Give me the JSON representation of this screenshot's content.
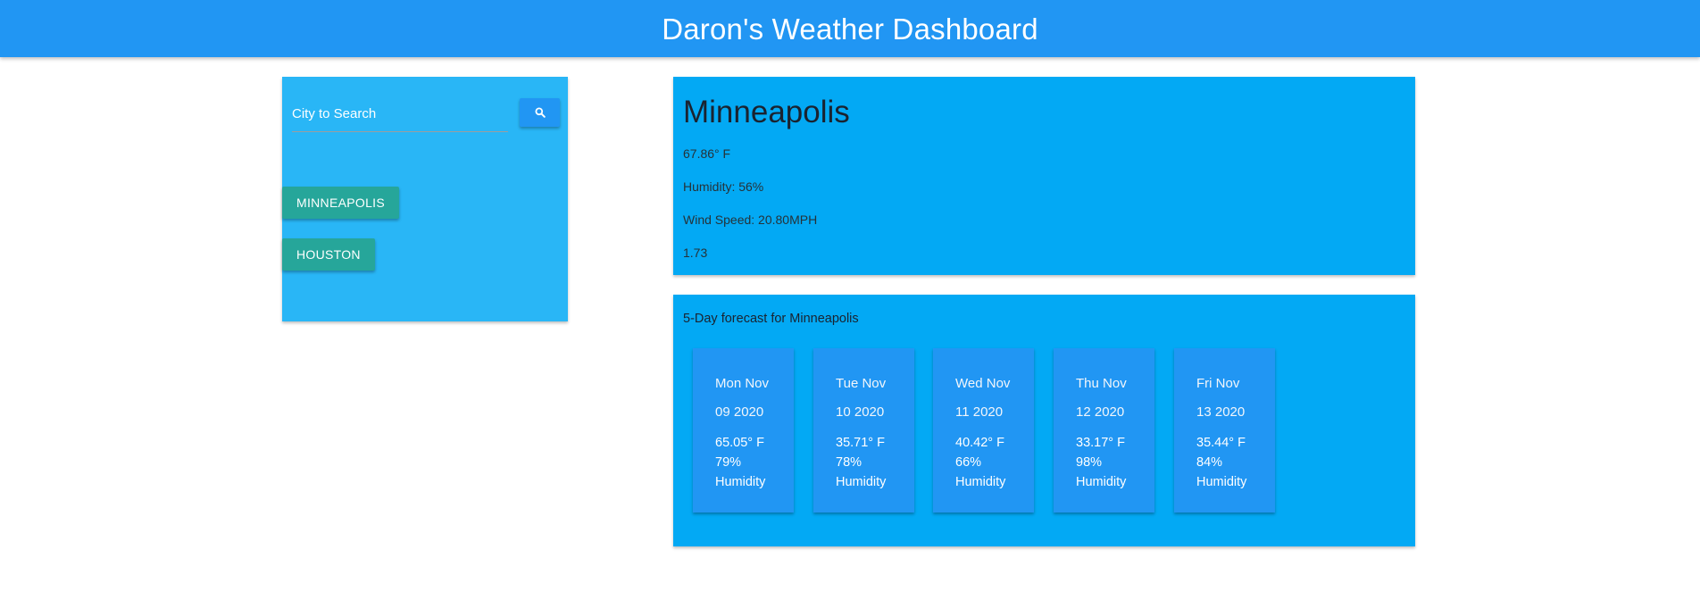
{
  "header": {
    "title": "Daron's Weather Dashboard",
    "color": "#2196f3"
  },
  "search": {
    "placeholder": "City to Search",
    "button_icon": "search-icon",
    "history": [
      {
        "label": "MINNEAPOLIS"
      },
      {
        "label": "HOUSTON"
      }
    ]
  },
  "current": {
    "city": "Minneapolis",
    "temp": "67.86° F",
    "humidity": "Humidity: 56%",
    "wind": "Wind Speed: 20.80MPH",
    "uv": "1.73"
  },
  "forecast": {
    "heading": "5-Day forecast for Minneapolis",
    "days": [
      {
        "day": "Mon Nov",
        "date": "09 2020",
        "temp": "65.05° F",
        "humidity": "79%",
        "humidity_label": "Humidity"
      },
      {
        "day": "Tue Nov",
        "date": "10 2020",
        "temp": "35.71° F",
        "humidity": "78%",
        "humidity_label": "Humidity"
      },
      {
        "day": "Wed Nov",
        "date": "11 2020",
        "temp": "40.42° F",
        "humidity": "66%",
        "humidity_label": "Humidity"
      },
      {
        "day": "Thu Nov",
        "date": "12 2020",
        "temp": "33.17° F",
        "humidity": "98%",
        "humidity_label": "Humidity"
      },
      {
        "day": "Fri Nov",
        "date": "13 2020",
        "temp": "35.44° F",
        "humidity": "84%",
        "humidity_label": "Humidity"
      }
    ]
  },
  "colors": {
    "search_panel": "#29b6f6",
    "content_panel": "#03a9f4",
    "city_button": "#26a69a",
    "card": "#2196f3"
  }
}
